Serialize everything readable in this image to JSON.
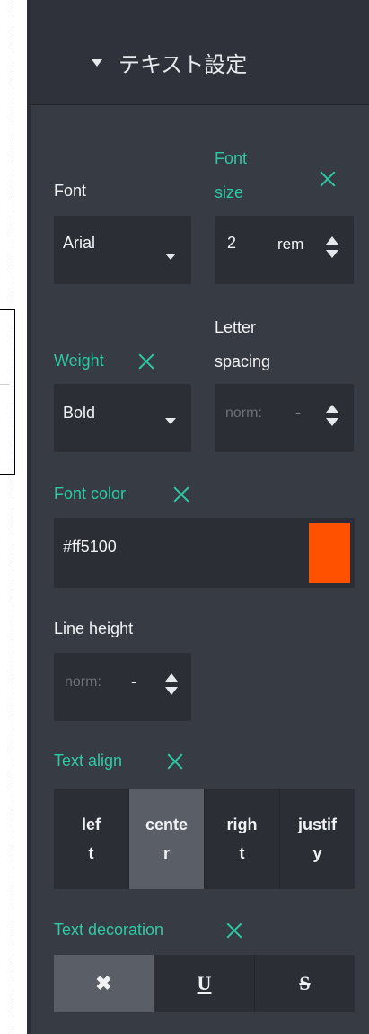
{
  "panel": {
    "section_title": "テキスト設定",
    "font": {
      "label": "Font",
      "value": "Arial"
    },
    "font_size": {
      "label_line1": "Font",
      "label_line2": "size",
      "value": "2",
      "unit": "rem"
    },
    "weight": {
      "label": "Weight",
      "value": "Bold"
    },
    "letter_spacing": {
      "label_line1": "Letter",
      "label_line2": "spacing",
      "value": "norm:",
      "unit": "-"
    },
    "font_color": {
      "label": "Font color",
      "value": "#ff5100",
      "swatch": "#ff5100"
    },
    "line_height": {
      "label": "Line height",
      "value": "norm:",
      "unit": "-"
    },
    "text_align": {
      "label": "Text align",
      "options": [
        {
          "line1": "lef",
          "line2": "t"
        },
        {
          "line1": "cente",
          "line2": "r"
        },
        {
          "line1": "righ",
          "line2": "t"
        },
        {
          "line1": "justif",
          "line2": "y"
        }
      ],
      "selected": "center"
    },
    "text_decoration": {
      "label": "Text decoration",
      "options": [
        "✖",
        "U",
        "S"
      ],
      "selected": "none"
    }
  },
  "colors": {
    "panel_bg": "#373b44",
    "field_bg": "#2b2e35",
    "accent": "#2ec9a3",
    "selected_bg": "#5a5e67"
  }
}
